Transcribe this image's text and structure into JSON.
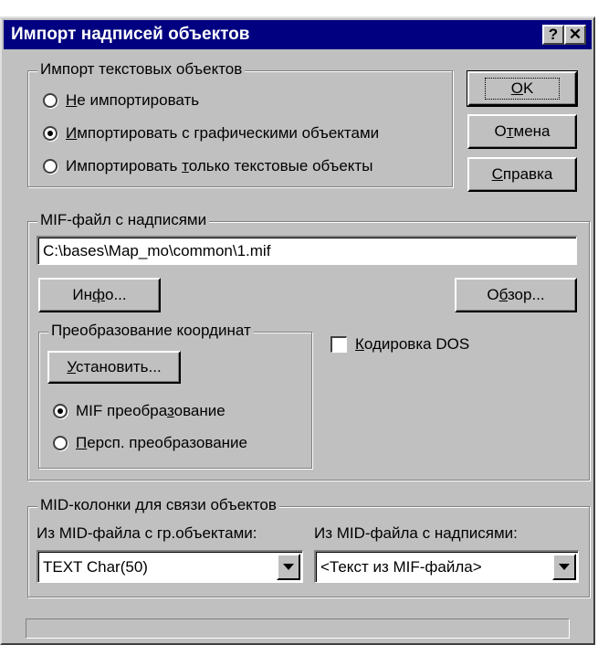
{
  "window": {
    "title": "Импорт надписей объектов",
    "help_glyph": "?",
    "close_glyph": "✕"
  },
  "import_text": {
    "legend": "Импорт текстовых объектов",
    "options": [
      {
        "before": "",
        "accel": "Н",
        "after": "е импортировать",
        "selected": false
      },
      {
        "before": "",
        "accel": "И",
        "after": "мпортировать с графическими объектами",
        "selected": true
      },
      {
        "before": "Импортировать ",
        "accel": "т",
        "after": "олько текстовые объекты",
        "selected": false
      }
    ]
  },
  "buttons": {
    "ok": {
      "before": "",
      "accel": "О",
      "after": "K"
    },
    "cancel": {
      "before": "О",
      "accel": "т",
      "after": "мена"
    },
    "help": {
      "before": "",
      "accel": "С",
      "after": "правка"
    }
  },
  "mif": {
    "legend": "MIF-файл с надписями",
    "path": "C:\\bases\\Map_mo\\common\\1.mif",
    "info": {
      "before": "Ин",
      "accel": "ф",
      "after": "о..."
    },
    "browse": {
      "before": "О",
      "accel": "б",
      "after": "зор..."
    },
    "dos": {
      "before": "",
      "accel": "К",
      "after": "одировка DOS",
      "checked": false
    }
  },
  "transform": {
    "legend": "Преобразование координат",
    "set": {
      "before": "",
      "accel": "У",
      "after": "становить..."
    },
    "options": [
      {
        "before": "MIF преобра",
        "accel": "з",
        "after": "ование",
        "selected": true
      },
      {
        "before": "",
        "accel": "П",
        "after": "ерсп. преобразование",
        "selected": false
      }
    ]
  },
  "mid": {
    "legend": "MID-колонки для связи объектов",
    "left_label": "Из MID-файла с гр.объектами:",
    "left_value": "TEXT Char(50)",
    "right_label": "Из MID-файла с надписями:",
    "right_value": "<Текст из MIF-файла>"
  }
}
